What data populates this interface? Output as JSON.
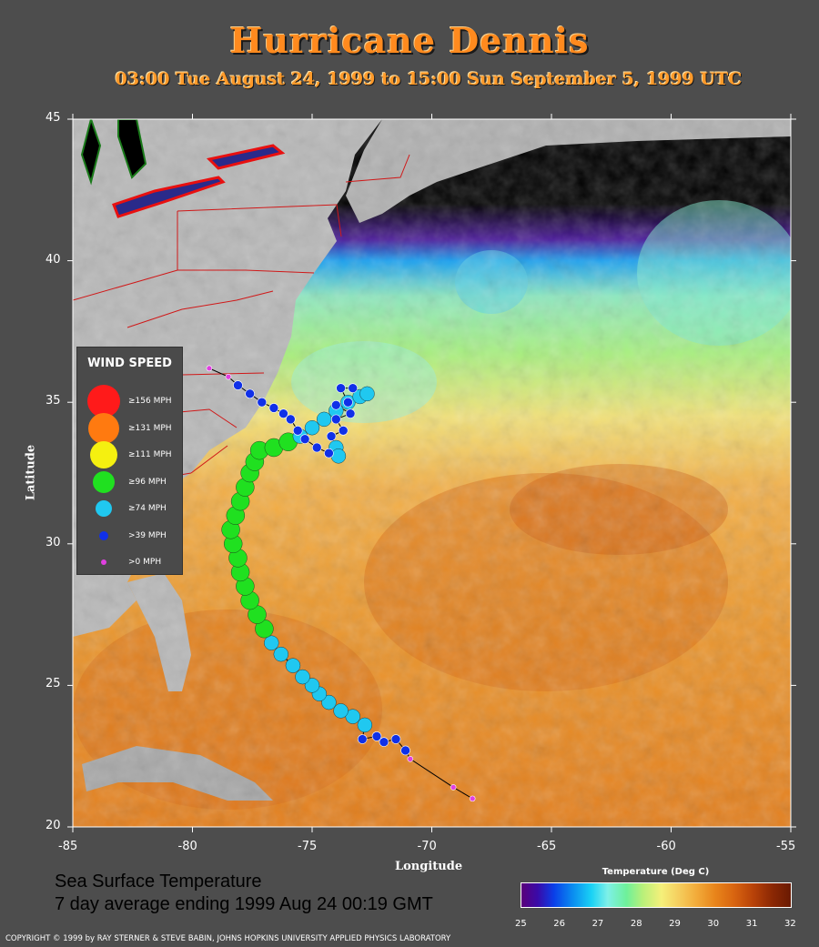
{
  "header": {
    "title": "Hurricane Dennis",
    "subtitle": "03:00 Tue August 24, 1999 to 15:00 Sun September  5, 1999  UTC"
  },
  "axes": {
    "xlabel": "Longitude",
    "ylabel": "Latitude",
    "lon_range": [
      -85,
      -55
    ],
    "lat_range": [
      20,
      45
    ],
    "x_ticks": [
      "-85",
      "-80",
      "-75",
      "-70",
      "-65",
      "-60",
      "-55"
    ],
    "y_ticks": [
      "45",
      "40",
      "35",
      "30",
      "25",
      "20"
    ]
  },
  "legend": {
    "title": "WIND SPEED",
    "items": [
      {
        "label": "≥156 MPH",
        "color": "#ff1a1a"
      },
      {
        "label": "≥131 MPH",
        "color": "#ff7a10"
      },
      {
        "label": "≥111 MPH",
        "color": "#f5f010"
      },
      {
        "label": "≥96 MPH",
        "color": "#20e020"
      },
      {
        "label": "≥74 MPH",
        "color": "#20c8f0"
      },
      {
        "label": ">39 MPH",
        "color": "#1030e8"
      },
      {
        "label": ">0 MPH",
        "color": "#e040e0"
      }
    ]
  },
  "sst": {
    "line1": "Sea Surface Temperature",
    "line2": "7 day average ending 1999 Aug 24 00:19 GMT"
  },
  "colorbar": {
    "title": "Temperature (Deg C)",
    "ticks": [
      "25",
      "26",
      "27",
      "28",
      "29",
      "30",
      "31",
      "32"
    ],
    "range": [
      25,
      32
    ]
  },
  "copyright": "COPYRIGHT © 1999 by RAY STERNER & STEVE BABIN, JOHNS HOPKINS UNIVERSITY APPLIED PHYSICS LABORATORY",
  "track": [
    {
      "lon": -68.3,
      "lat": 21.0,
      "cat": 6
    },
    {
      "lon": -69.1,
      "lat": 21.4,
      "cat": 6
    },
    {
      "lon": -70.9,
      "lat": 22.4,
      "cat": 6
    },
    {
      "lon": -71.1,
      "lat": 22.7,
      "cat": 5
    },
    {
      "lon": -71.5,
      "lat": 23.1,
      "cat": 5
    },
    {
      "lon": -72.0,
      "lat": 23.0,
      "cat": 5
    },
    {
      "lon": -72.3,
      "lat": 23.2,
      "cat": 5
    },
    {
      "lon": -72.9,
      "lat": 23.1,
      "cat": 5
    },
    {
      "lon": -72.8,
      "lat": 23.6,
      "cat": 4
    },
    {
      "lon": -73.3,
      "lat": 23.9,
      "cat": 4
    },
    {
      "lon": -73.8,
      "lat": 24.1,
      "cat": 4
    },
    {
      "lon": -74.3,
      "lat": 24.4,
      "cat": 4
    },
    {
      "lon": -74.7,
      "lat": 24.7,
      "cat": 4
    },
    {
      "lon": -75.0,
      "lat": 25.0,
      "cat": 4
    },
    {
      "lon": -75.4,
      "lat": 25.3,
      "cat": 4
    },
    {
      "lon": -75.8,
      "lat": 25.7,
      "cat": 4
    },
    {
      "lon": -76.3,
      "lat": 26.1,
      "cat": 4
    },
    {
      "lon": -76.7,
      "lat": 26.5,
      "cat": 4
    },
    {
      "lon": -77.0,
      "lat": 27.0,
      "cat": 3
    },
    {
      "lon": -77.3,
      "lat": 27.5,
      "cat": 3
    },
    {
      "lon": -77.6,
      "lat": 28.0,
      "cat": 3
    },
    {
      "lon": -77.8,
      "lat": 28.5,
      "cat": 3
    },
    {
      "lon": -78.0,
      "lat": 29.0,
      "cat": 3
    },
    {
      "lon": -78.1,
      "lat": 29.5,
      "cat": 3
    },
    {
      "lon": -78.3,
      "lat": 30.0,
      "cat": 3
    },
    {
      "lon": -78.4,
      "lat": 30.5,
      "cat": 3
    },
    {
      "lon": -78.2,
      "lat": 31.0,
      "cat": 3
    },
    {
      "lon": -78.0,
      "lat": 31.5,
      "cat": 3
    },
    {
      "lon": -77.8,
      "lat": 32.0,
      "cat": 3
    },
    {
      "lon": -77.6,
      "lat": 32.5,
      "cat": 3
    },
    {
      "lon": -77.4,
      "lat": 32.9,
      "cat": 3
    },
    {
      "lon": -77.2,
      "lat": 33.3,
      "cat": 3
    },
    {
      "lon": -76.6,
      "lat": 33.4,
      "cat": 3
    },
    {
      "lon": -76.0,
      "lat": 33.6,
      "cat": 3
    },
    {
      "lon": -75.5,
      "lat": 33.8,
      "cat": 4
    },
    {
      "lon": -75.0,
      "lat": 34.1,
      "cat": 4
    },
    {
      "lon": -74.5,
      "lat": 34.4,
      "cat": 4
    },
    {
      "lon": -74.0,
      "lat": 34.7,
      "cat": 4
    },
    {
      "lon": -73.5,
      "lat": 35.0,
      "cat": 4
    },
    {
      "lon": -73.0,
      "lat": 35.2,
      "cat": 4
    },
    {
      "lon": -72.7,
      "lat": 35.3,
      "cat": 4
    },
    {
      "lon": -73.3,
      "lat": 35.5,
      "cat": 5
    },
    {
      "lon": -73.8,
      "lat": 35.5,
      "cat": 5
    },
    {
      "lon": -73.5,
      "lat": 35.0,
      "cat": 5
    },
    {
      "lon": -74.0,
      "lat": 34.9,
      "cat": 5
    },
    {
      "lon": -73.4,
      "lat": 34.6,
      "cat": 5
    },
    {
      "lon": -74.0,
      "lat": 34.4,
      "cat": 5
    },
    {
      "lon": -73.7,
      "lat": 34.0,
      "cat": 5
    },
    {
      "lon": -74.2,
      "lat": 33.8,
      "cat": 5
    },
    {
      "lon": -74.0,
      "lat": 33.4,
      "cat": 4
    },
    {
      "lon": -73.9,
      "lat": 33.1,
      "cat": 4
    },
    {
      "lon": -74.3,
      "lat": 33.2,
      "cat": 5
    },
    {
      "lon": -74.8,
      "lat": 33.4,
      "cat": 5
    },
    {
      "lon": -75.3,
      "lat": 33.7,
      "cat": 5
    },
    {
      "lon": -75.6,
      "lat": 34.0,
      "cat": 5
    },
    {
      "lon": -75.9,
      "lat": 34.4,
      "cat": 5
    },
    {
      "lon": -76.2,
      "lat": 34.6,
      "cat": 5
    },
    {
      "lon": -76.6,
      "lat": 34.8,
      "cat": 5
    },
    {
      "lon": -77.1,
      "lat": 35.0,
      "cat": 5
    },
    {
      "lon": -77.6,
      "lat": 35.3,
      "cat": 5
    },
    {
      "lon": -78.1,
      "lat": 35.6,
      "cat": 5
    },
    {
      "lon": -78.5,
      "lat": 35.9,
      "cat": 6
    },
    {
      "lon": -79.3,
      "lat": 36.2,
      "cat": 6
    }
  ]
}
